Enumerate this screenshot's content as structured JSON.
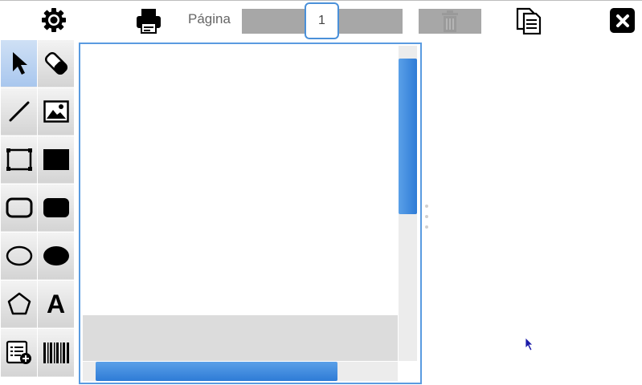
{
  "toolbar": {
    "settings_icon": "gear-icon",
    "print_icon": "printer-icon",
    "page_label": "Página",
    "page_value": "1",
    "delete_icon": "trash-icon",
    "copy_icon": "copy-document-icon",
    "close_icon": "close-icon"
  },
  "tools": [
    {
      "name": "select-tool",
      "icon": "arrow-pointer-icon",
      "selected": true
    },
    {
      "name": "eraser-tool",
      "icon": "eraser-icon"
    },
    {
      "name": "line-tool",
      "icon": "line-icon"
    },
    {
      "name": "image-tool",
      "icon": "image-icon"
    },
    {
      "name": "rectangle-outline-tool",
      "icon": "rectangle-outline-icon"
    },
    {
      "name": "rectangle-filled-tool",
      "icon": "rectangle-filled-icon"
    },
    {
      "name": "rounded-rectangle-outline-tool",
      "icon": "rounded-rectangle-outline-icon"
    },
    {
      "name": "rounded-rectangle-filled-tool",
      "icon": "rounded-rectangle-filled-icon"
    },
    {
      "name": "ellipse-outline-tool",
      "icon": "ellipse-outline-icon"
    },
    {
      "name": "ellipse-filled-tool",
      "icon": "ellipse-filled-icon"
    },
    {
      "name": "polygon-tool",
      "icon": "pentagon-icon"
    },
    {
      "name": "text-tool",
      "icon": "text-a-icon",
      "glyph": "A"
    },
    {
      "name": "variable-field-tool",
      "icon": "list-add-icon"
    },
    {
      "name": "barcode-tool",
      "icon": "barcode-icon"
    }
  ],
  "colors": {
    "accent": "#4a90d9",
    "scroll_thumb": "#2e7bd6",
    "toolbar_block": "#a7a7a7",
    "selected_tool": "#a9c7ee"
  }
}
